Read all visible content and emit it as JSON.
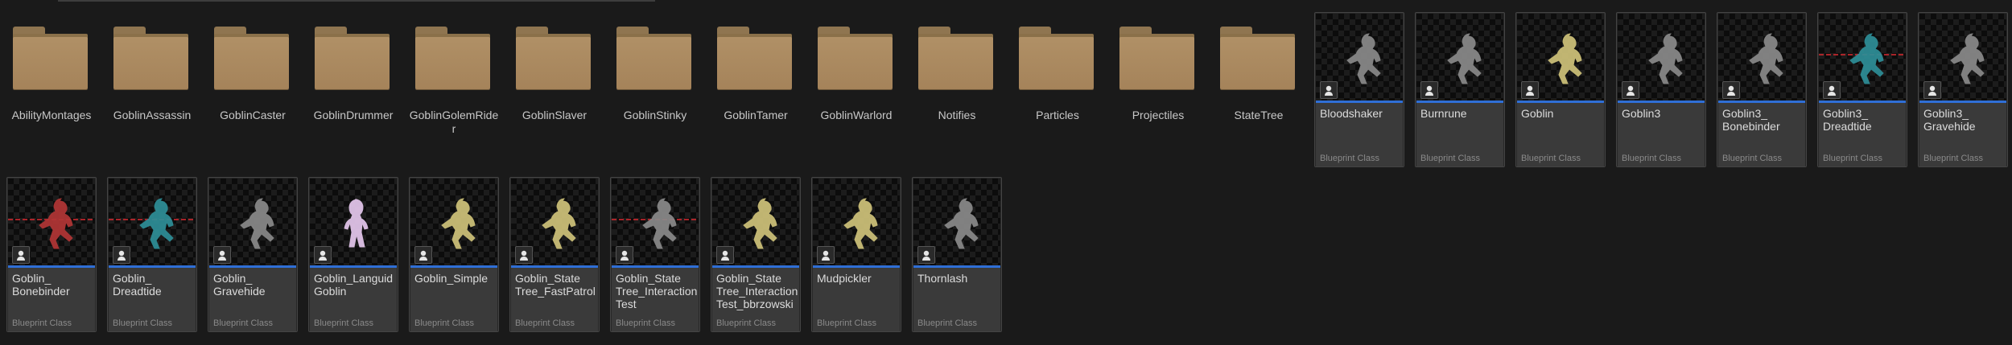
{
  "folders": [
    {
      "label": "AbilityMontages",
      "icon": "folder-icon"
    },
    {
      "label": "GoblinAssassin",
      "icon": "folder-icon"
    },
    {
      "label": "GoblinCaster",
      "icon": "folder-icon"
    },
    {
      "label": "GoblinDrummer",
      "icon": "folder-icon"
    },
    {
      "label": "GoblinGolemRider",
      "icon": "folder-icon"
    },
    {
      "label": "GoblinSlaver",
      "icon": "folder-icon"
    },
    {
      "label": "GoblinStinky",
      "icon": "folder-icon"
    },
    {
      "label": "GoblinTamer",
      "icon": "folder-icon"
    },
    {
      "label": "GoblinWarlord",
      "icon": "folder-icon"
    },
    {
      "label": "Notifies",
      "icon": "folder-icon"
    },
    {
      "label": "Particles",
      "icon": "folder-icon"
    },
    {
      "label": "Projectiles",
      "icon": "folder-icon"
    },
    {
      "label": "StateTree",
      "icon": "folder-icon"
    }
  ],
  "assets": [
    {
      "name": "Bloodshaker",
      "type": "Blueprint Class",
      "tint": "#8a8a8a",
      "debug_line": false,
      "pose": "crouch"
    },
    {
      "name": "Burnrune",
      "type": "Blueprint Class",
      "tint": "#8a8a8a",
      "debug_line": false,
      "pose": "crouch"
    },
    {
      "name": "Goblin",
      "type": "Blueprint Class",
      "tint": "#cfc37a",
      "debug_line": false,
      "pose": "crouch"
    },
    {
      "name": "Goblin3",
      "type": "Blueprint Class",
      "tint": "#8a8a8a",
      "debug_line": false,
      "pose": "crouch"
    },
    {
      "name": "Goblin3_\nBonebinder",
      "type": "Blueprint Class",
      "tint": "#8a8a8a",
      "debug_line": false,
      "pose": "crouch"
    },
    {
      "name": "Goblin3_\nDreadtide",
      "type": "Blueprint Class",
      "tint": "#2e8f98",
      "debug_line": true,
      "pose": "crouch"
    },
    {
      "name": "Goblin3_\nGravehide",
      "type": "Blueprint Class",
      "tint": "#8a8a8a",
      "debug_line": false,
      "pose": "crouch"
    },
    {
      "name": "Goblin_\nBonebinder",
      "type": "Blueprint Class",
      "tint": "#b23636",
      "debug_line": true,
      "pose": "crouch"
    },
    {
      "name": "Goblin_\nDreadtide",
      "type": "Blueprint Class",
      "tint": "#2e8f98",
      "debug_line": true,
      "pose": "crouch"
    },
    {
      "name": "Goblin_\nGravehide",
      "type": "Blueprint Class",
      "tint": "#8a8a8a",
      "debug_line": false,
      "pose": "crouch"
    },
    {
      "name": "Goblin_Languid\nGoblin",
      "type": "Blueprint Class",
      "tint": "#e6c8ee",
      "debug_line": false,
      "pose": "stand"
    },
    {
      "name": "Goblin_Simple",
      "type": "Blueprint Class",
      "tint": "#cfc37a",
      "debug_line": false,
      "pose": "crouch"
    },
    {
      "name": "Goblin_State\nTree_FastPatrol",
      "type": "Blueprint Class",
      "tint": "#cfc37a",
      "debug_line": false,
      "pose": "crouch"
    },
    {
      "name": "Goblin_State\nTree_Interaction\nTest",
      "type": "Blueprint Class",
      "tint": "#8a8a8a",
      "debug_line": true,
      "pose": "crouch"
    },
    {
      "name": "Goblin_State\nTree_Interaction\nTest_bbrzowski",
      "type": "Blueprint Class",
      "tint": "#cfc37a",
      "debug_line": false,
      "pose": "crouch"
    },
    {
      "name": "Mudpickler",
      "type": "Blueprint Class",
      "tint": "#cfc37a",
      "debug_line": false,
      "pose": "crouch"
    },
    {
      "name": "Thornlash",
      "type": "Blueprint Class",
      "tint": "#8a8a8a",
      "debug_line": false,
      "pose": "crouch"
    }
  ],
  "class_icon": "blueprint-class-icon",
  "accent_color": "#2f6fd6"
}
